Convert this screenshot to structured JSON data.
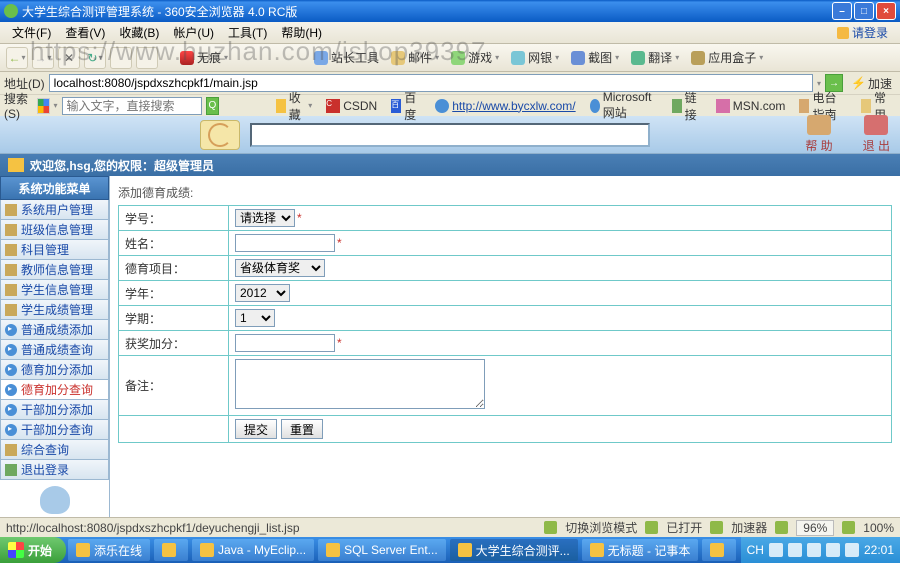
{
  "window": {
    "title": "大学生综合测评管理系统 - 360安全浏览器 4.0 RC版",
    "min": "–",
    "max": "□",
    "close": "×"
  },
  "menu": {
    "file": "文件(F)",
    "view": "查看(V)",
    "fav": "收藏(B)",
    "account": "帐户(U)",
    "tool": "工具(T)",
    "help": "帮助(H)",
    "login": "请登录"
  },
  "watermark": "https://www.huzhan.com/ishop39397",
  "toolbar": {
    "noimg": "无痕",
    "home": "",
    "site_tools": "站长工具",
    "mail": "邮件",
    "game": "游戏",
    "net": "网银",
    "snap": "截图",
    "trans": "翻译",
    "appbox": "应用盒子"
  },
  "addr": {
    "label": "地址(D)",
    "value": "localhost:8080/jspdxszhcpkf1/main.jsp",
    "go": "→",
    "do": "加速"
  },
  "search": {
    "label": "搜索(S)",
    "placeholder": "输入文字，直接搜索"
  },
  "bookmarks": {
    "fav": "收藏",
    "csdn": "CSDN",
    "baidu": "百度",
    "byc": "http://www.bycxlw.com/",
    "ms": "Microsoft 网站",
    "link": "链接",
    "msn": "MSN.com",
    "radio": "电台指南",
    "common": "常用"
  },
  "apphdr": {
    "help": "帮 助",
    "exit": "退 出"
  },
  "welcome": "欢迎您,hsg,您的权限：超级管理员",
  "sidebar": {
    "header": "系统功能菜单",
    "items": [
      {
        "label": "系统用户管理",
        "icon": "key"
      },
      {
        "label": "班级信息管理",
        "icon": "key"
      },
      {
        "label": "科目管理",
        "icon": "key"
      },
      {
        "label": "教师信息管理",
        "icon": "key"
      },
      {
        "label": "学生信息管理",
        "icon": "key"
      },
      {
        "label": "学生成绩管理",
        "icon": "key"
      },
      {
        "label": "普通成绩添加",
        "icon": "arrow"
      },
      {
        "label": "普通成绩查询",
        "icon": "arrow"
      },
      {
        "label": "德育加分添加",
        "icon": "arrow"
      },
      {
        "label": "德育加分查询",
        "icon": "arrow",
        "active": true
      },
      {
        "label": "干部加分添加",
        "icon": "arrow"
      },
      {
        "label": "干部加分查询",
        "icon": "arrow"
      },
      {
        "label": "综合查询",
        "icon": "key"
      },
      {
        "label": "退出登录",
        "icon": "exit"
      }
    ]
  },
  "form": {
    "crumb": "添加德育成绩:",
    "f_no": "学号：",
    "v_no": "请选择",
    "f_name": "姓名：",
    "f_proj": "德育项目：",
    "v_proj": "省级体育奖",
    "f_year": "学年：",
    "v_year": "2012",
    "f_term": "学期：",
    "v_term": "1",
    "f_bonus": "获奖加分：",
    "f_note": "备注：",
    "submit": "提交",
    "reset": "重置",
    "star": "*"
  },
  "status": {
    "url": "http://localhost:8080/jspdxszhcpkf1/deyuchengji_list.jsp",
    "mode": "切换浏览模式",
    "download": "已打开",
    "speed": "加速器",
    "zoom": "96%",
    "sound": "100%"
  },
  "taskbar": {
    "start": "开始",
    "tasks": [
      "添乐在线",
      "",
      "Java - MyEclip...",
      "SQL Server Ent...",
      "大学生综合测评...",
      "无标题 - 记事本",
      ""
    ],
    "time": "22:01"
  }
}
